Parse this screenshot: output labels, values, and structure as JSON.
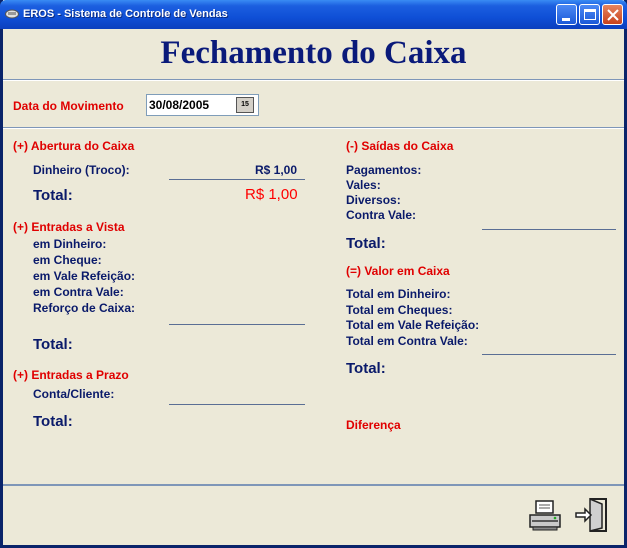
{
  "window": {
    "title": "EROS - Sistema de Controle de Vendas"
  },
  "heading": "Fechamento do Caixa",
  "date": {
    "label": "Data do Movimento",
    "value": "30/08/2005",
    "calendar_glyph": "15"
  },
  "left": {
    "abertura": {
      "title": "(+) Abertura do Caixa",
      "rows": [
        {
          "label": "Dinheiro (Troco):",
          "value": "R$ 1,00"
        }
      ],
      "total_label": "Total:",
      "total_value": "R$ 1,00"
    },
    "entradas_vista": {
      "title": "(+) Entradas a Vista",
      "rows": [
        {
          "label": "em Dinheiro:"
        },
        {
          "label": "em Cheque:"
        },
        {
          "label": "em Vale Refeição:"
        },
        {
          "label": "em Contra Vale:"
        },
        {
          "label": "Reforço de Caixa:"
        }
      ],
      "total_label": "Total:"
    },
    "entradas_prazo": {
      "title": "(+) Entradas a Prazo",
      "rows": [
        {
          "label": "Conta/Cliente:"
        }
      ],
      "total_label": "Total:"
    }
  },
  "right": {
    "saidas": {
      "title": "(-) Saídas do Caixa",
      "rows": [
        {
          "label": "Pagamentos:"
        },
        {
          "label": "Vales:"
        },
        {
          "label": "Diversos:"
        },
        {
          "label": "Contra Vale:"
        }
      ],
      "total_label": "Total:"
    },
    "valor_caixa": {
      "title": "(=) Valor em Caixa",
      "rows": [
        {
          "label": "Total em Dinheiro:"
        },
        {
          "label": "Total em Cheques:"
        },
        {
          "label": "Total em Vale Refeição:"
        },
        {
          "label": "Total em Contra Vale:"
        }
      ],
      "total_label": "Total:"
    },
    "diferenca_label": "Diferença"
  },
  "icons": {
    "print": "printer-icon",
    "exit": "exit-door-icon"
  },
  "colors": {
    "title_blue": "#0A1A7A",
    "label_red": "#E00000",
    "total_red": "#FF0000",
    "titlebar": "#0F4FD6"
  }
}
